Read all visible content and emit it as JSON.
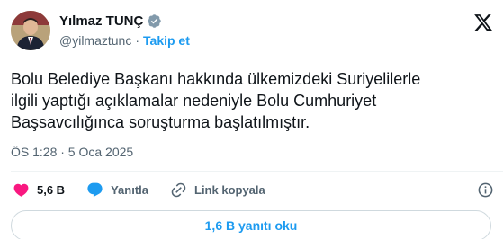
{
  "author": {
    "display_name": "Yılmaz TUNÇ",
    "handle": "@yilmaztunc",
    "separator": "·",
    "follow_label": "Takip et",
    "verified_badge": "gray-verified-badge-icon"
  },
  "tweet": {
    "text_lines": [
      "Bolu Belediye Başkanı hakkında ülkemizdeki Suriyelilerle",
      "ilgili yaptığı açıklamalar nedeniyle Bolu Cumhuriyet",
      "Başsavcılığınca soruşturma başlatılmıştır."
    ],
    "timestamp": "ÖS 1:28 · 5 Oca 2025"
  },
  "actions": {
    "like_count": "5,6 B",
    "reply_label": "Yanıtla",
    "copy_link_label": "Link kopyala"
  },
  "replies_button_label": "1,6 B yanıtı oku",
  "icons": [
    "heart-icon",
    "reply-bubble-icon",
    "link-icon",
    "info-icon",
    "x-logo-icon"
  ],
  "colors": {
    "accent": "#1d9bf0",
    "like": "#f91880",
    "secondary_text": "#536471",
    "primary_text": "#0f1419",
    "border": "#cfd9de"
  }
}
